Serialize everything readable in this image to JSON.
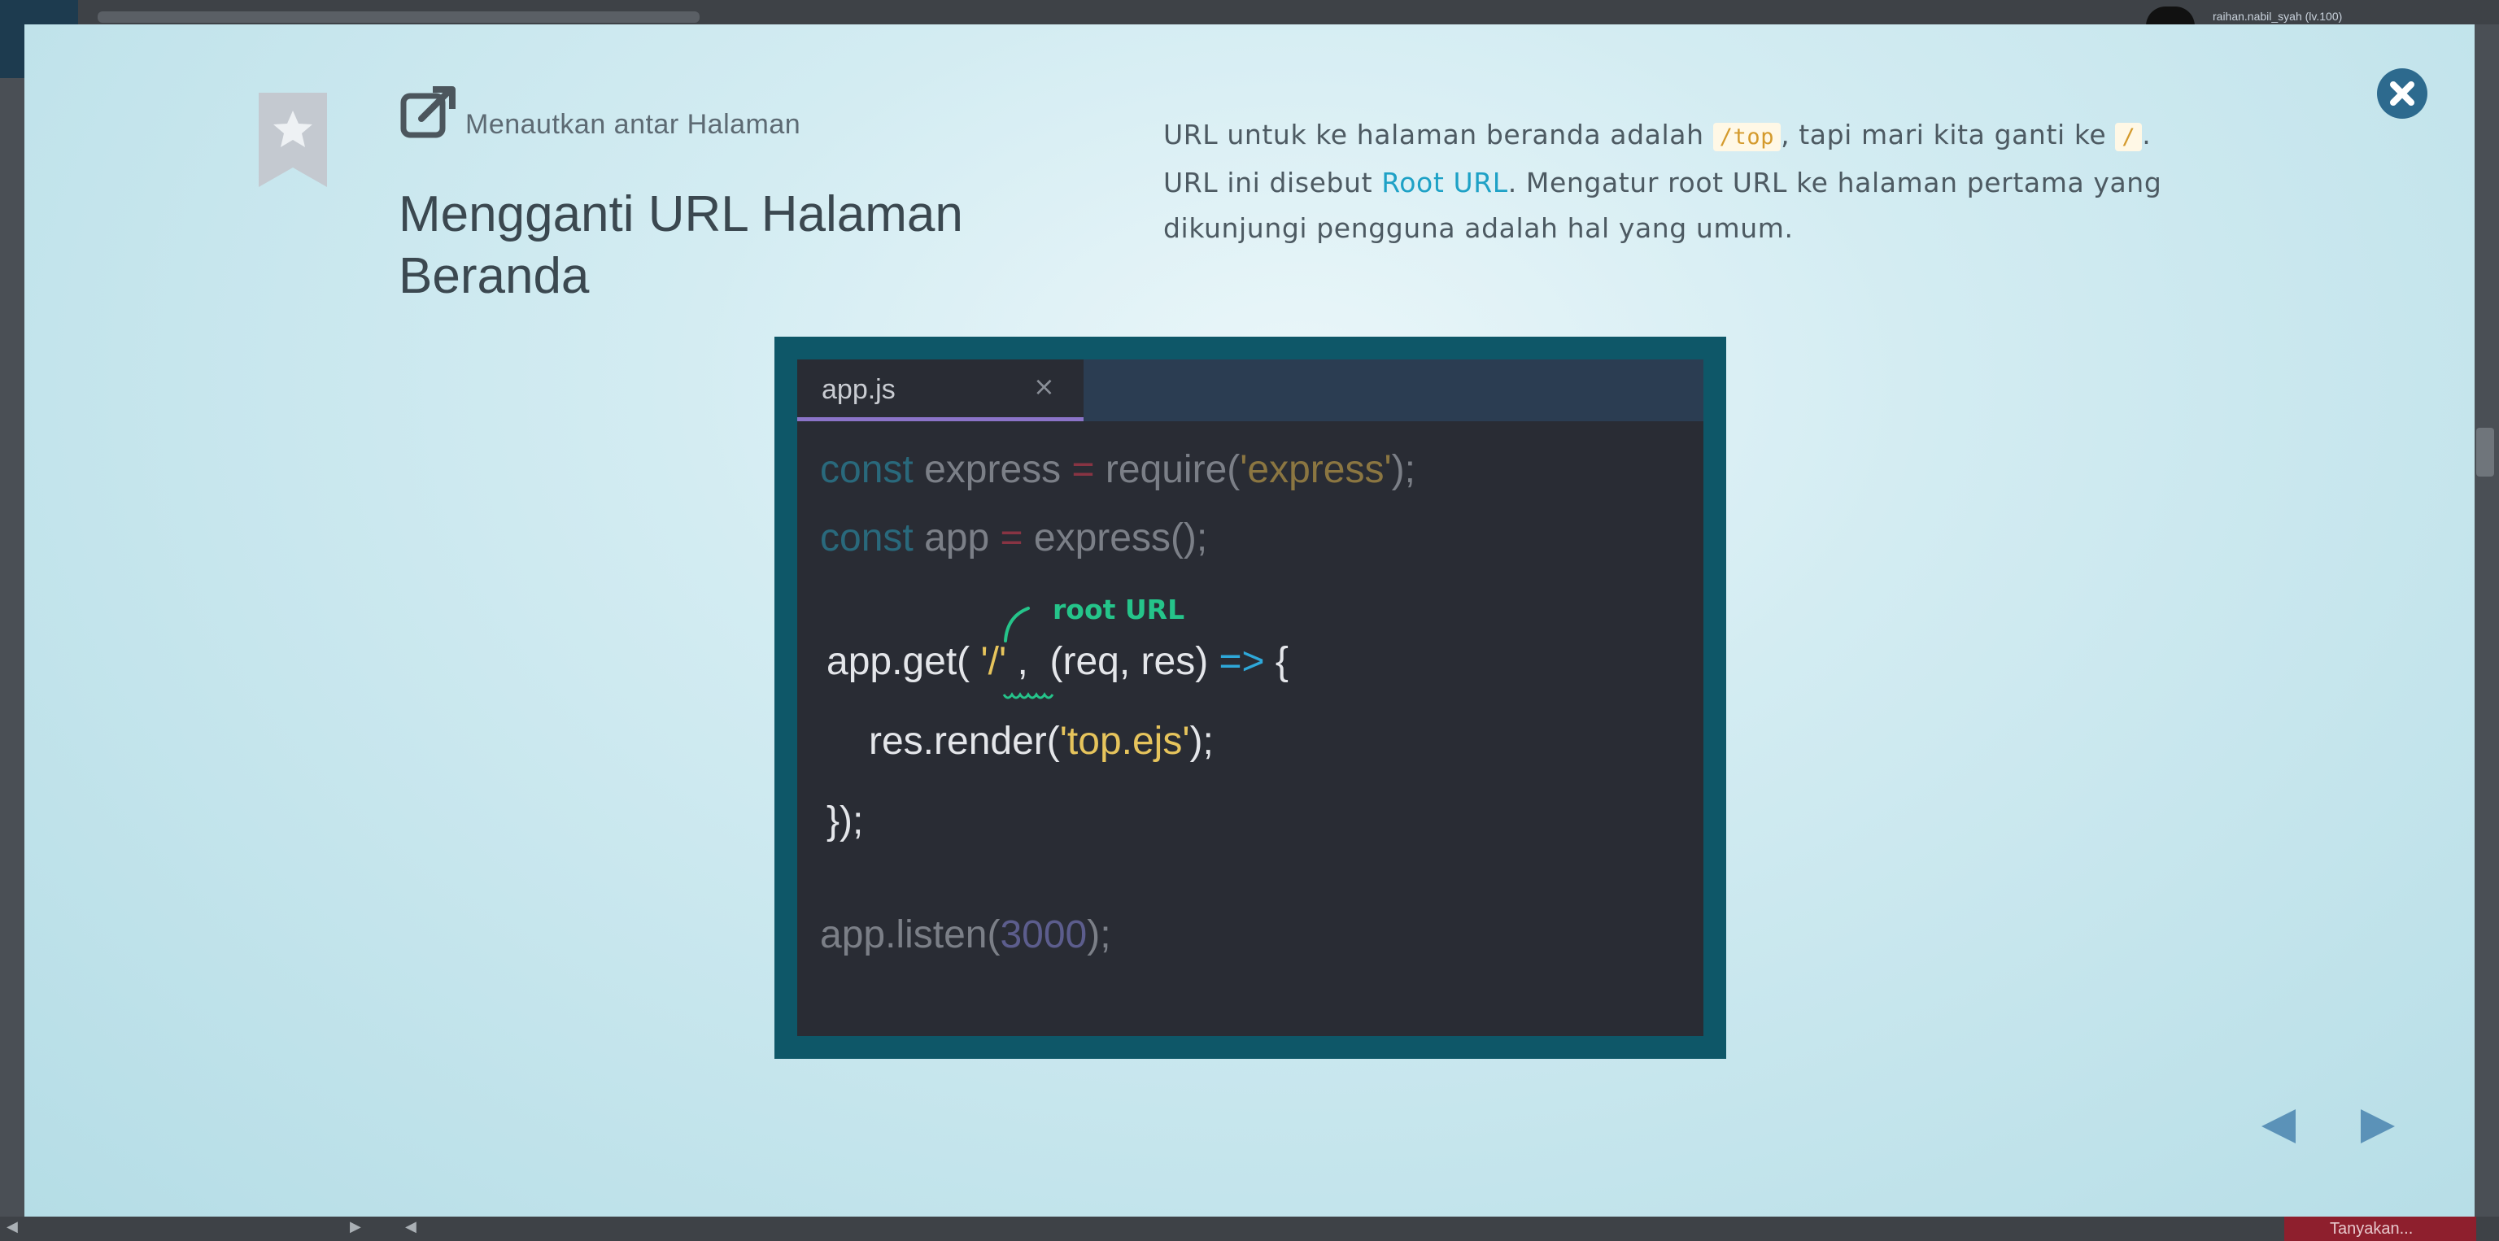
{
  "background": {
    "username": "raihan.nabil_syah (lv.100)",
    "bottom_button": "Tanyakan..."
  },
  "header": {
    "chapter": "Menautkan antar Halaman",
    "title_line1": "Mengganti URL Halaman",
    "title_line2": "Beranda"
  },
  "description": {
    "p1_before": "URL untuk ke halaman beranda adalah ",
    "p1_code1": "/top",
    "p1_middle": ", tapi mari kita ganti ke ",
    "p1_code2": "/",
    "p1_after": ".",
    "p2_before": "URL ini disebut ",
    "p2_link": "Root URL",
    "p2_after": ". Mengatur root URL ke halaman pertama yang dikunjungi pengguna adalah hal yang umum."
  },
  "editor": {
    "tab_name": "app.js",
    "tab_close": "×",
    "line1": {
      "kw": "const",
      "id": " express ",
      "eq": "=",
      "call": " require(",
      "str": "'express'",
      "end": ");"
    },
    "line2": {
      "kw": "const",
      "id": " app ",
      "eq": "=",
      "call": " express();"
    },
    "line3": {
      "a": "app.get( ",
      "str": "'/'",
      "b": " ,  (req, res) ",
      "arrow": "=>",
      "c": " {"
    },
    "line4": {
      "a": "res.render(",
      "str": "'top.ejs'",
      "b": ");"
    },
    "line5": "});",
    "line6": {
      "a": "app.listen(",
      "num": "3000",
      "b": ");"
    },
    "annotation": "root URL"
  },
  "icons": {
    "bookmark": "bookmark-star-icon",
    "external_link": "external-link-icon",
    "close": "close-icon",
    "prev": "triangle-left-icon",
    "next": "triangle-right-icon"
  },
  "colors": {
    "modal_bg": "#d3ecf2",
    "close_button": "#2d6a8e",
    "code_frame": "#0e5768",
    "editor_bg": "#292c34",
    "link": "#1ea1c6",
    "annotation": "#25c48a",
    "nav_arrows": "#5b92b8"
  }
}
